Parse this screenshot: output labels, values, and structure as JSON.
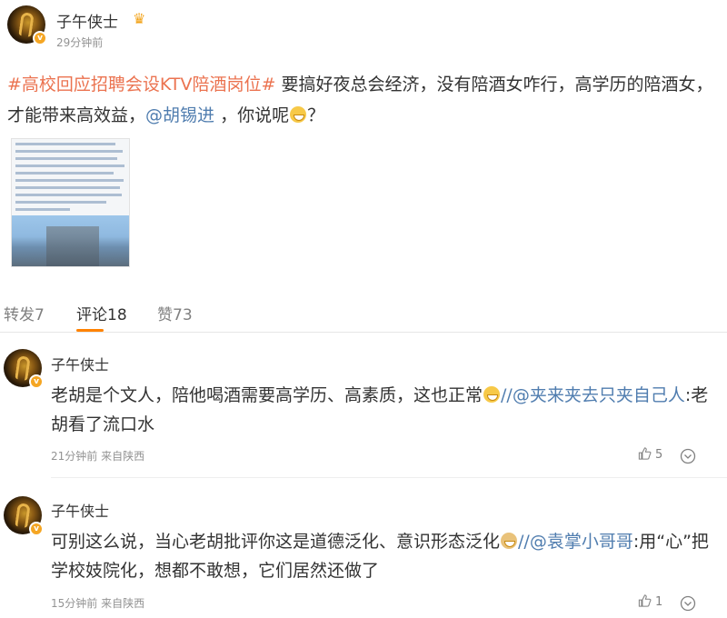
{
  "post": {
    "author": "子午侠士",
    "time": "29分钟前",
    "hashtag": "#高校回应招聘会设KTV陪酒岗位#",
    "text_1": " 要搞好夜总会经济，没有陪酒女咋行，高学历的陪酒女，才能带来高效益，",
    "mention": "@胡锡进",
    "text_2": " ，你说呢",
    "text_3": "？",
    "emoji": "laughing-tears-emoji"
  },
  "tabs": {
    "repost": "转发7",
    "comment": "评论18",
    "like": "赞73"
  },
  "comments": [
    {
      "author": "子午侠士",
      "text_1": "老胡是个文人，陪他喝酒需要高学历、高素质，这也正常",
      "emoji": "grin-emoji",
      "sep": "//",
      "mention": "@夹来夹去只夹自己人",
      "text_2": ":老胡看了流口水",
      "meta": "21分钟前 来自陕西",
      "likes": "5"
    },
    {
      "author": "子午侠士",
      "text_1": "可别这么说，当心老胡批评你这是道德泛化、意识形态泛化",
      "emoji": "doge-emoji",
      "sep": "//",
      "mention": "@袁掌小哥哥",
      "text_2": ":用“心”把学校妓院化，想都不敢想，它们居然还做了",
      "meta": "15分钟前 来自陕西",
      "likes": "1"
    }
  ],
  "colors": {
    "hashtag": "#eb7350",
    "mention": "#507daf",
    "accent": "#ff8200",
    "muted": "#939393"
  }
}
